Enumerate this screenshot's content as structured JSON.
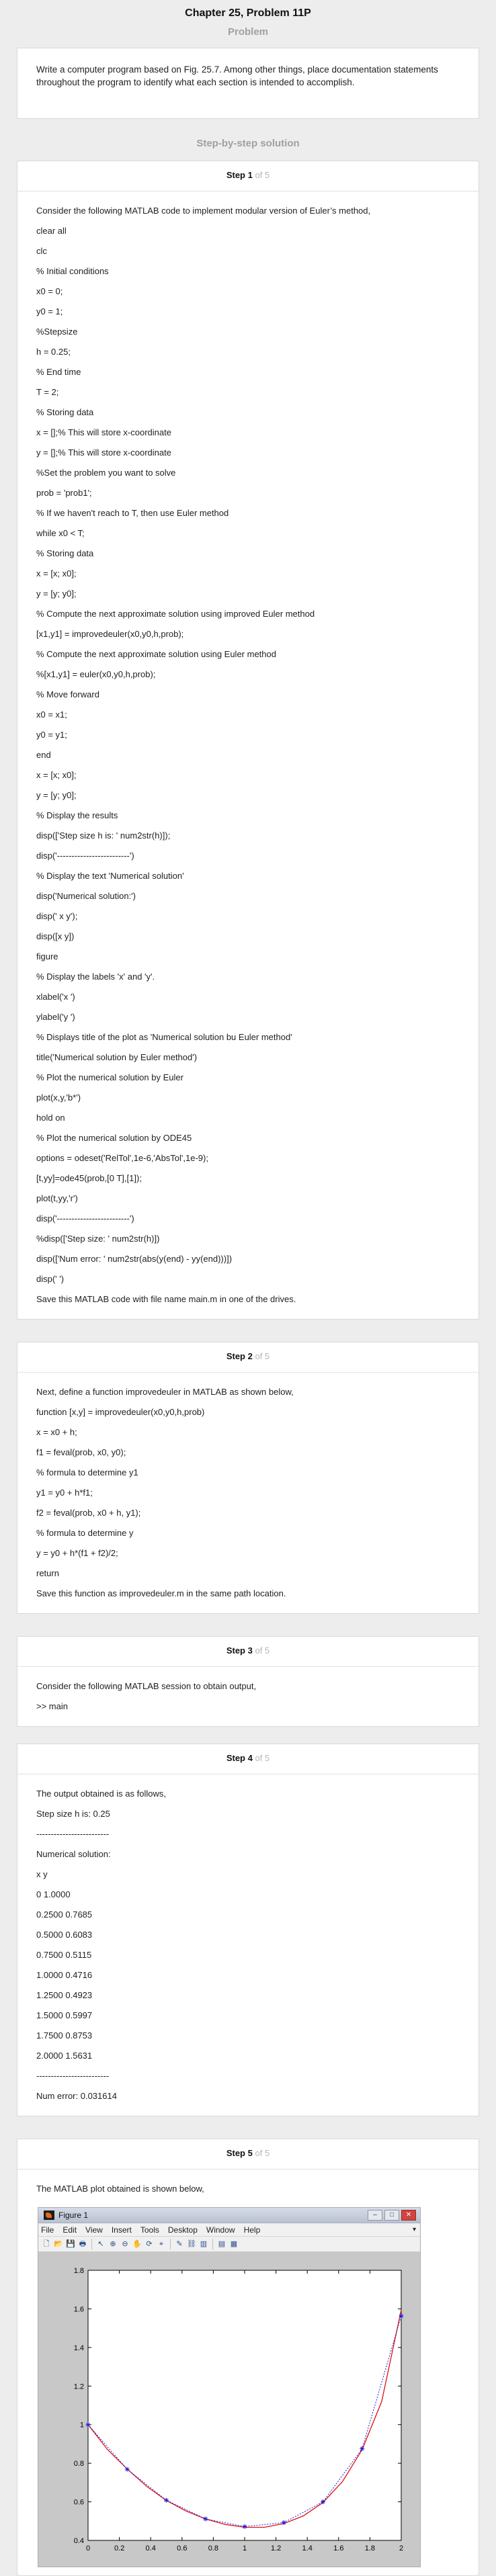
{
  "header": {
    "title": "Chapter 25, Problem 11P"
  },
  "problem": {
    "heading": "Problem",
    "text": "Write a computer program based on Fig. 25.7. Among other things, place documentation statements throughout the program to identify what each section is intended to accomplish."
  },
  "solution": {
    "heading": "Step-by-step solution",
    "of_total": "of 5",
    "steps": [
      {
        "label": "Step 1",
        "lines": [
          "Consider the following MATLAB code to implement modular version of Euler’s method,",
          "clear all",
          "clc",
          "% Initial conditions",
          "x0 = 0;",
          "y0 = 1;",
          "%Stepsize",
          "h = 0.25;",
          "% End time",
          "T = 2;",
          "% Storing data",
          "x = [];% This will store x-coordinate",
          "y = [];% This will store x-coordinate",
          "%Set the problem you want to solve",
          "prob = 'prob1';",
          "% If we haven't reach to T, then use Euler method",
          "while x0 < T;",
          "% Storing data",
          "x = [x; x0];",
          "y = [y; y0];",
          "% Compute the next approximate solution using improved Euler method",
          "[x1,y1] = improvedeuler(x0,y0,h,prob);",
          "% Compute the next approximate solution using Euler method",
          "%[x1,y1] = euler(x0,y0,h,prob);",
          "% Move forward",
          "x0 = x1;",
          "y0 = y1;",
          "end",
          "x = [x; x0];",
          "y = [y; y0];",
          "% Display the results",
          "disp(['Step size h is: ' num2str(h)]);",
          "disp('-------------------------')",
          "% Display the text 'Numerical solution'",
          "disp('Numerical solution:')",
          "disp(' x y');",
          "disp([x y])",
          "figure",
          "% Display the labels 'x' and 'y'.",
          "xlabel('x ')",
          "ylabel('y ')",
          "% Displays title of the plot as 'Numerical solution bu Euler method'",
          "title('Numerical solution by Euler method')",
          "% Plot the numerical solution by Euler",
          "plot(x,y,'b*')",
          "hold on",
          "% Plot the numerical solution by ODE45",
          "options = odeset('RelTol',1e-6,'AbsTol',1e-9);",
          "[t,yy]=ode45(prob,[0 T],[1]);",
          "plot(t,yy,'r')",
          "disp('-------------------------')",
          "%disp(['Step size: ' num2str(h)])",
          "disp(['Num error: ' num2str(abs(y(end) - yy(end)))])",
          "disp(' ')",
          "Save this MATLAB code with file name main.m in one of the drives."
        ]
      },
      {
        "label": "Step 2",
        "lines": [
          "Next, define a function improvedeuler in MATLAB as shown below,",
          "function [x,y] = improvedeuler(x0,y0,h,prob)",
          "x = x0 + h;",
          "f1 = feval(prob, x0, y0);",
          "% formula to determine y1",
          "y1 = y0 + h*f1;",
          "f2 = feval(prob, x0 + h, y1);",
          "% formula to determine y",
          "y = y0 + h*(f1 + f2)/2;",
          "return",
          "Save this function as improvedeuler.m in the same path location."
        ]
      },
      {
        "label": "Step 3",
        "lines": [
          "Consider the following MATLAB session to obtain output,",
          ">> main"
        ]
      },
      {
        "label": "Step 4",
        "lines": [
          "The output obtained is as follows,",
          "Step size h is: 0.25",
          "-------------------------",
          "Numerical solution:",
          "x y",
          "0 1.0000",
          "0.2500 0.7685",
          "0.5000 0.6083",
          "0.7500 0.5115",
          "1.0000 0.4716",
          "1.2500 0.4923",
          "1.5000 0.5997",
          "1.7500 0.8753",
          "2.0000 1.5631",
          "-------------------------",
          "Num error: 0.031614"
        ]
      },
      {
        "label": "Step 5",
        "lines": [
          "The MATLAB plot obtained is shown below,"
        ]
      }
    ]
  },
  "figure": {
    "window_title": "Figure 1",
    "menus": [
      "File",
      "Edit",
      "View",
      "Insert",
      "Tools",
      "Desktop",
      "Window",
      "Help"
    ],
    "toolbar_icons": [
      "new-file-icon",
      "open-folder-icon",
      "save-icon",
      "print-icon",
      "pointer-icon",
      "zoom-in-icon",
      "zoom-out-icon",
      "pan-icon",
      "rotate-icon",
      "data-cursor-icon",
      "brush-icon",
      "link-icon",
      "colorbar-icon",
      "legend-icon",
      "grid-layout-icon"
    ],
    "colors": {
      "axes_bg": "#ffffff",
      "figure_bg": "#c8c8c8",
      "numeric_series": "#1f1fd6",
      "ode45_series": "#e01010"
    }
  },
  "chart_data": {
    "type": "line",
    "xlim": [
      0,
      2
    ],
    "ylim": [
      0.4,
      1.8
    ],
    "xticks": [
      0,
      0.2,
      0.4,
      0.6,
      0.8,
      1,
      1.2,
      1.4,
      1.6,
      1.8,
      2
    ],
    "yticks": [
      0.4,
      0.6,
      0.8,
      1,
      1.2,
      1.4,
      1.6,
      1.8
    ],
    "grid": false,
    "series": [
      {
        "style": "markers",
        "marker": "*",
        "color": "#1f1fd6",
        "x": [
          0,
          0.25,
          0.5,
          0.75,
          1.0,
          1.25,
          1.5,
          1.75,
          2.0
        ],
        "y": [
          1.0,
          0.7685,
          0.6083,
          0.5115,
          0.4716,
          0.4923,
          0.5997,
          0.8753,
          1.5631
        ]
      },
      {
        "style": "line",
        "color": "#e01010",
        "x": [
          0,
          0.125,
          0.25,
          0.375,
          0.5,
          0.625,
          0.75,
          0.875,
          1.0,
          1.125,
          1.25,
          1.375,
          1.5,
          1.625,
          1.75,
          1.875,
          2.0
        ],
        "y": [
          1.0,
          0.87,
          0.77,
          0.68,
          0.607,
          0.553,
          0.511,
          0.483,
          0.468,
          0.468,
          0.487,
          0.527,
          0.596,
          0.705,
          0.87,
          1.12,
          1.595
        ]
      }
    ]
  }
}
